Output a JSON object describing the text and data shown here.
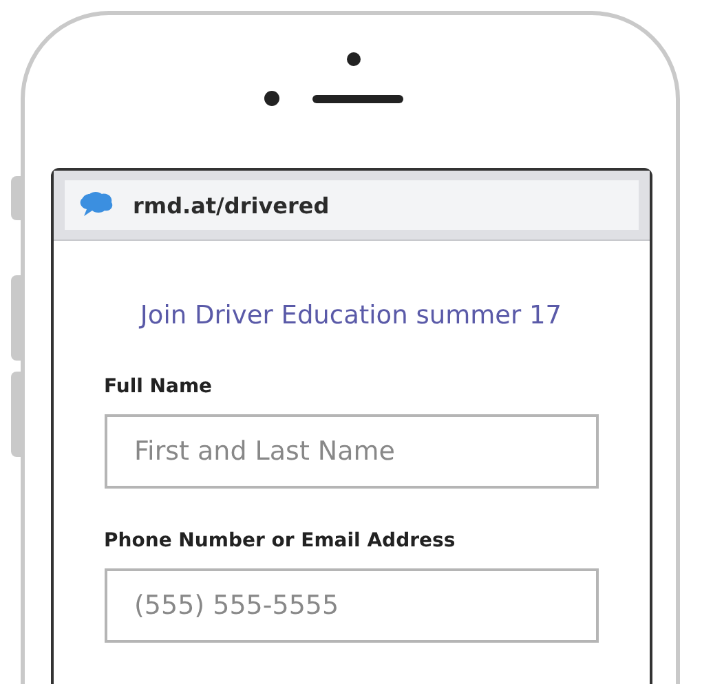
{
  "browser": {
    "url": "rmd.at/drivered"
  },
  "form": {
    "title": "Join Driver Education summer 17",
    "fields": [
      {
        "label": "Full Name",
        "placeholder": "First and Last Name"
      },
      {
        "label": "Phone Number or Email Address",
        "placeholder": "(555) 555-5555"
      }
    ]
  }
}
